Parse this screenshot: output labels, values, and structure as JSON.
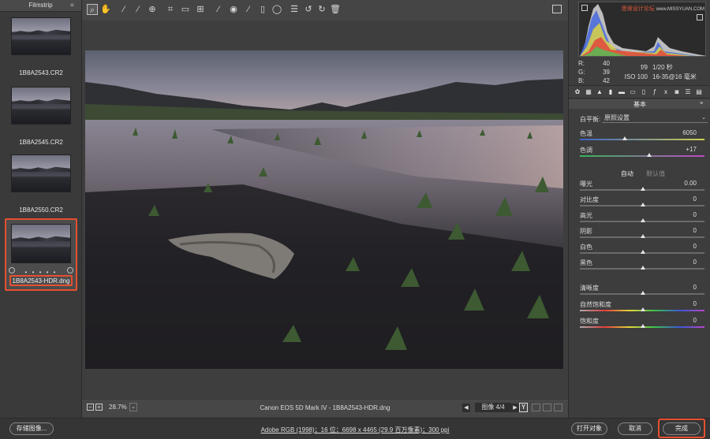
{
  "filmstrip": {
    "title": "Filmstrip",
    "items": [
      {
        "label": "1B8A2543.CR2"
      },
      {
        "label": "1B8A2545.CR2"
      },
      {
        "label": "1B8A2550.CR2"
      },
      {
        "label": "1B8A2543-HDR.dng",
        "selected": true,
        "rating_dots": "• • • • •"
      }
    ]
  },
  "toolbar": {
    "tools": [
      "zoom-icon",
      "hand-icon",
      "white-balance-icon",
      "color-sampler-icon",
      "targeted-adjust-icon",
      "crop-icon",
      "straighten-icon",
      "transform-icon",
      "spot-removal-icon",
      "red-eye-icon",
      "adjustment-brush-icon",
      "graduated-filter-icon",
      "radial-filter-icon",
      "presets-list-icon",
      "rotate-left-icon",
      "rotate-right-icon",
      "trash-icon"
    ]
  },
  "statusbar": {
    "zoom": "28.7%",
    "camera_info": "Canon EOS 5D Mark IV - 1B8A2543-HDR.dng",
    "image_count": "图像 4/4",
    "y_label": "Y"
  },
  "histogram_readout": {
    "r_label": "R:",
    "r": "40",
    "g_label": "G:",
    "g": "39",
    "b_label": "B:",
    "b": "42"
  },
  "watermark": {
    "cn": "思缘设计论坛",
    "url": "www.MISSYUAN.COM"
  },
  "exif": {
    "aperture": "f/9",
    "shutter": "1/20 秒",
    "iso": "ISO 100",
    "lens": "16-35@16 毫米"
  },
  "panel": {
    "title": "基本",
    "wb_label": "白平衡:",
    "wb_value": "原照设置",
    "temp_label": "色温",
    "temp_value": "6050",
    "temp_pos": 0.36,
    "tint_label": "色调",
    "tint_value": "+17",
    "tint_pos": 0.55,
    "auto": "自动",
    "default": "默认值",
    "sliders": [
      {
        "key": "exposure",
        "label": "曝光",
        "value": "0.00"
      },
      {
        "key": "contrast",
        "label": "对比度",
        "value": "0"
      },
      {
        "key": "highlights",
        "label": "高光",
        "value": "0"
      },
      {
        "key": "shadows",
        "label": "阴影",
        "value": "0"
      },
      {
        "key": "whites",
        "label": "白色",
        "value": "0"
      },
      {
        "key": "blacks",
        "label": "黑色",
        "value": "0"
      },
      {
        "key": "clarity",
        "label": "清晰度",
        "value": "0"
      },
      {
        "key": "vibrance",
        "label": "自然饱和度",
        "value": "0"
      },
      {
        "key": "saturation",
        "label": "饱和度",
        "value": "0"
      }
    ]
  },
  "bottom": {
    "save_label": "存储图像...",
    "workflow": "Adobe RGB (1998)；16 位；6698 x 4465 (29.9 百万像素)；300 ppi",
    "open_label": "打开对象",
    "cancel_label": "取消",
    "done_label": "完成"
  },
  "colors": {
    "highlight": "#e5502f"
  }
}
